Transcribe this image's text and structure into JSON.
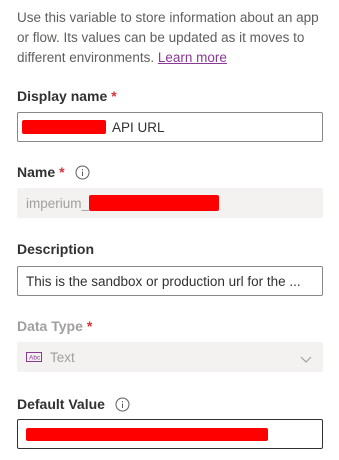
{
  "intro": {
    "text": "Use this variable to store information about an app or flow. Its values can be updated as it moves to different environments.",
    "learn_more": "Learn more"
  },
  "display_name": {
    "label": "Display name",
    "required_mark": "*",
    "value_suffix": "API URL"
  },
  "name": {
    "label": "Name",
    "required_mark": "*",
    "value_prefix": "imperium_"
  },
  "description": {
    "label": "Description",
    "value": "This is the sandbox or production url for the ..."
  },
  "data_type": {
    "label": "Data Type",
    "required_mark": "*",
    "selected": "Text",
    "icon": "text-type-icon"
  },
  "default_value": {
    "label": "Default Value"
  },
  "colors": {
    "link": "#8a3a96",
    "required": "#d13438",
    "redaction": "#ff0000"
  }
}
